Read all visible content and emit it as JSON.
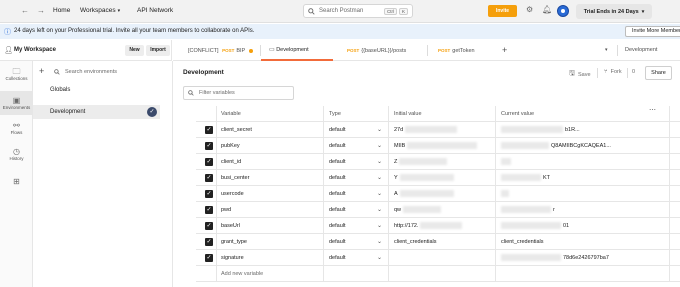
{
  "topbar": {
    "back_icon": "←",
    "forward_icon": "→",
    "home": "Home",
    "workspaces": "Workspaces",
    "api_network": "API Network",
    "search_placeholder": "Search Postman",
    "kbd_ctrl": "Ctrl",
    "kbd_k": "K",
    "invite": "Invite",
    "trial": "Trial Ends in 24 Days"
  },
  "banner": {
    "text": "24 days left on your Professional trial. Invite all your team members to collaborate on APIs.",
    "button": "Invite More Members"
  },
  "workspace": {
    "name": "My Workspace",
    "new": "New",
    "import": "Import"
  },
  "tabs": [
    {
      "prefix": "[CONFLICT]",
      "method": "POST",
      "label": "BIP"
    },
    {
      "label": "Development"
    },
    {
      "method": "POST",
      "label": "{{baseURL}}/posts"
    },
    {
      "method": "POST",
      "label": "getToken"
    }
  ],
  "tab_plus": "+",
  "env_selector": "Development",
  "rail": [
    {
      "label": "Collections",
      "icon": "collections-icon"
    },
    {
      "label": "Environments",
      "icon": "environments-icon"
    },
    {
      "label": "Flows",
      "icon": "flows-icon"
    },
    {
      "label": "History",
      "icon": "history-icon"
    },
    {
      "label": "",
      "icon": "add-icon"
    }
  ],
  "env_sidebar": {
    "search_placeholder": "Search environments",
    "items": [
      "Globals",
      "Development"
    ]
  },
  "main": {
    "title": "Development",
    "save": "Save",
    "fork": "Fork",
    "fork_count": "0",
    "share": "Share",
    "filter_placeholder": "Filter variables"
  },
  "table": {
    "headers": {
      "variable": "Variable",
      "type": "Type",
      "initial": "Initial value",
      "current": "Current value"
    },
    "rows": [
      {
        "variable": "client_secret",
        "type": "default",
        "initial": "27d",
        "current": "b1R..."
      },
      {
        "variable": "pubKey",
        "type": "default",
        "initial": "MIIB",
        "current": "Q8AMIIBCgKCAQEA1..."
      },
      {
        "variable": "client_id",
        "type": "default",
        "initial": "Z",
        "current": ""
      },
      {
        "variable": "busi_center",
        "type": "default",
        "initial": "Y",
        "current": "KT"
      },
      {
        "variable": "usercode",
        "type": "default",
        "initial": "A",
        "current": ""
      },
      {
        "variable": "pwd",
        "type": "default",
        "initial": "qw",
        "current": "r"
      },
      {
        "variable": "baseUrl",
        "type": "default",
        "initial": "http://172.",
        "current": "01"
      },
      {
        "variable": "grant_type",
        "type": "default",
        "initial": "client_credentials",
        "current": "client_credentials"
      },
      {
        "variable": "signature",
        "type": "default",
        "initial": "",
        "current": "78d6e2426797ba7"
      }
    ],
    "add_label": "Add new variable"
  },
  "colors": {
    "accent": "#f59f0b",
    "active_tab": "#f26b3a",
    "banner_bg": "#e8f1fb"
  }
}
